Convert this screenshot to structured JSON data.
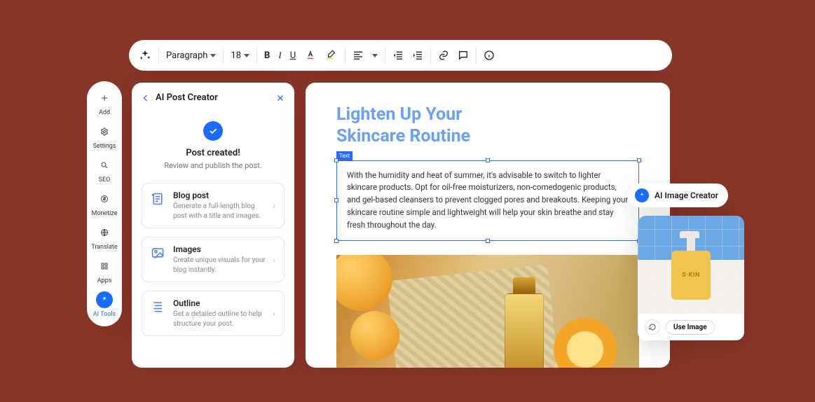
{
  "toolbar": {
    "style_select": "Paragraph",
    "font_size": "18"
  },
  "rail": {
    "items": [
      {
        "label": "Add"
      },
      {
        "label": "Settings"
      },
      {
        "label": "SEO"
      },
      {
        "label": "Monetize"
      },
      {
        "label": "Translate"
      },
      {
        "label": "Apps"
      },
      {
        "label": "AI Tools"
      }
    ]
  },
  "panel": {
    "title": "AI Post Creator",
    "status_title": "Post created!",
    "status_sub": "Review and publish the post.",
    "cards": [
      {
        "title": "Blog post",
        "desc": "Generate a full-length blog post with a title and images."
      },
      {
        "title": "Images",
        "desc": "Create unique visuals for your blog instantly."
      },
      {
        "title": "Outline",
        "desc": "Get a detailed outline to help structure your post."
      }
    ]
  },
  "editor": {
    "title_line1": "Lighten Up Your",
    "title_line2": "Skincare Routine",
    "selection_tag": "Text",
    "body": "With the humidity and heat of summer, it's advisable to switch to lighter skincare products. Opt for oil-free moisturizers, non-comedogenic products, and gel-based cleansers to prevent clogged pores and breakouts. Keeping your skincare routine simple and lightweight will help your skin breathe and stay fresh throughout the day."
  },
  "image_creator": {
    "label": "AI Image Creator",
    "product_label": "S·KIN",
    "use_button": "Use Image"
  }
}
